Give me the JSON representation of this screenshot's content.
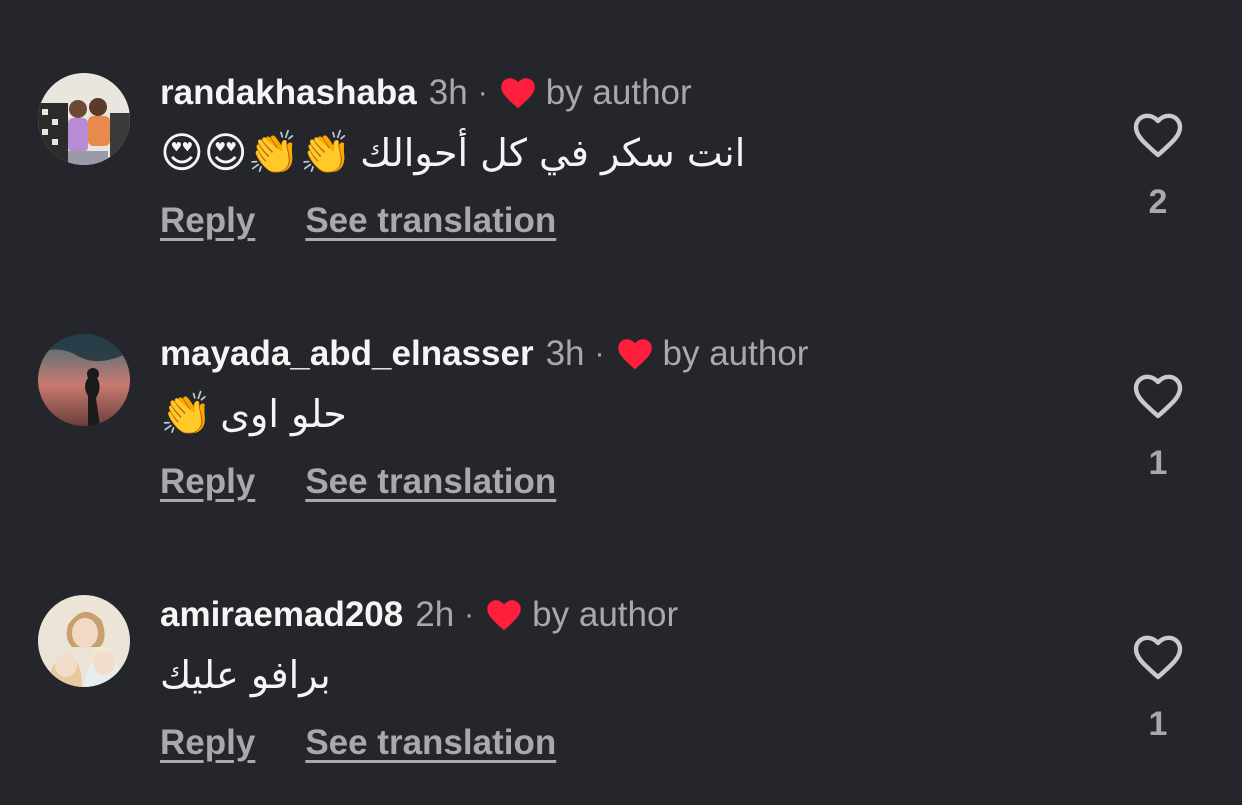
{
  "colors": {
    "background": "#25262b",
    "primary_text": "#f5f5f5",
    "secondary_text": "#a8a9ad",
    "heart_red": "#ff2d55"
  },
  "comments": [
    {
      "username": "randakhashaba",
      "time": "3h",
      "separator": "·",
      "badge_icon": "red-heart-icon",
      "badge_label": "by author",
      "text": "انت سكر في كل أحوالك",
      "emojis": "😍😍👏👏",
      "reply_label": "Reply",
      "translate_label": "See translation",
      "like_icon": "heart-outline-icon",
      "like_count": "2"
    },
    {
      "username": "mayada_abd_elnasser",
      "time": "3h",
      "separator": "·",
      "badge_icon": "red-heart-icon",
      "badge_label": "by author",
      "text": "حلو اوى",
      "emojis": "👏",
      "reply_label": "Reply",
      "translate_label": "See translation",
      "like_icon": "heart-outline-icon",
      "like_count": "1"
    },
    {
      "username": "amiraemad208",
      "time": "2h",
      "separator": "·",
      "badge_icon": "red-heart-icon",
      "badge_label": "by author",
      "text": "برافو عليك",
      "emojis": "",
      "reply_label": "Reply",
      "translate_label": "See translation",
      "like_icon": "heart-outline-icon",
      "like_count": "1"
    }
  ]
}
